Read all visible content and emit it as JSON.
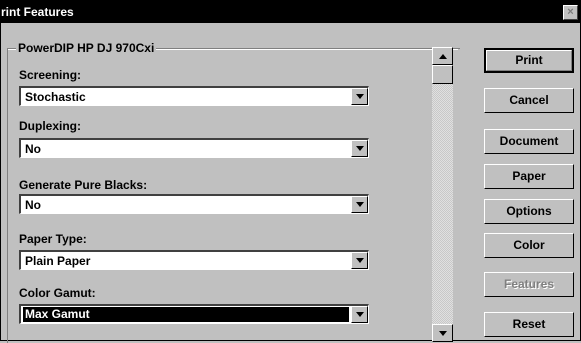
{
  "window": {
    "title": "rint Features",
    "close_glyph": "×"
  },
  "group": {
    "legend": "PowerDIP HP DJ 970Cxi"
  },
  "settings": [
    {
      "label": "Screening:",
      "value": "Stochastic",
      "selected": false
    },
    {
      "label": "Duplexing:",
      "value": "No",
      "selected": false
    },
    {
      "label": "Generate Pure Blacks:",
      "value": "No",
      "selected": false
    },
    {
      "label": "Paper Type:",
      "value": "Plain Paper",
      "selected": false
    },
    {
      "label": "Color Gamut:",
      "value": "Max Gamut",
      "selected": true
    }
  ],
  "buttons": {
    "print": "Print",
    "cancel": "Cancel",
    "document": "Document",
    "paper": "Paper",
    "options": "Options",
    "color": "Color",
    "features": "Features",
    "reset": "Reset"
  }
}
